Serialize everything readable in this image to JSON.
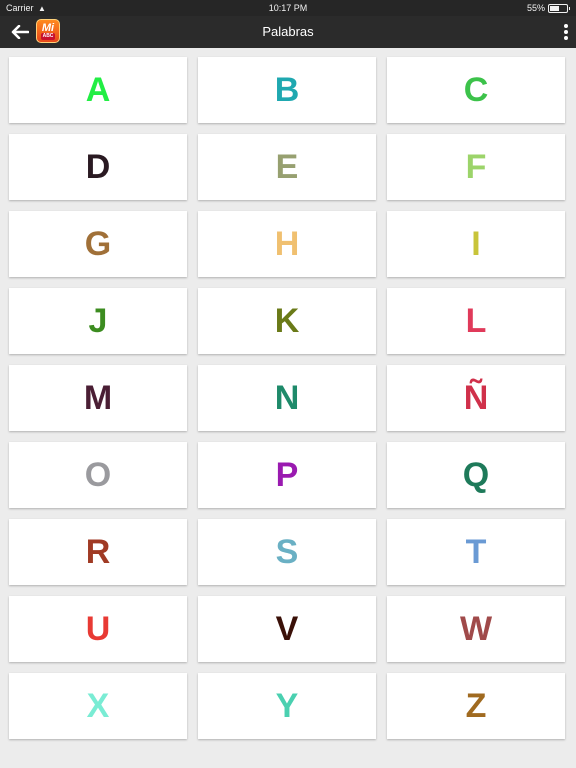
{
  "status_bar": {
    "carrier": "Carrier",
    "time": "10:17 PM",
    "battery": "55%",
    "battery_level": 0.55
  },
  "nav": {
    "title": "Palabras",
    "back_icon": "arrow-left-icon",
    "logo": {
      "top": "Mi",
      "bottom": "ABC"
    },
    "menu_icon": "more-vertical-icon"
  },
  "letters": [
    {
      "letter": "A",
      "color": "#22ee44"
    },
    {
      "letter": "B",
      "color": "#1fa8b0"
    },
    {
      "letter": "C",
      "color": "#3cc24a"
    },
    {
      "letter": "D",
      "color": "#2a1a22"
    },
    {
      "letter": "E",
      "color": "#97a070"
    },
    {
      "letter": "F",
      "color": "#9cd46a"
    },
    {
      "letter": "G",
      "color": "#a07038"
    },
    {
      "letter": "H",
      "color": "#f0c070"
    },
    {
      "letter": "I",
      "color": "#c8c43a"
    },
    {
      "letter": "J",
      "color": "#3c8c20"
    },
    {
      "letter": "K",
      "color": "#6a7a18"
    },
    {
      "letter": "L",
      "color": "#e03a5a"
    },
    {
      "letter": "M",
      "color": "#4a1e34"
    },
    {
      "letter": "N",
      "color": "#1e8a6a"
    },
    {
      "letter": "Ñ",
      "color": "#d0304a"
    },
    {
      "letter": "O",
      "color": "#9a9a9e"
    },
    {
      "letter": "P",
      "color": "#9a1ab0"
    },
    {
      "letter": "Q",
      "color": "#1e7a5a"
    },
    {
      "letter": "R",
      "color": "#a03a24"
    },
    {
      "letter": "S",
      "color": "#6ab0c4"
    },
    {
      "letter": "T",
      "color": "#6a9ad4"
    },
    {
      "letter": "U",
      "color": "#e83a34"
    },
    {
      "letter": "V",
      "color": "#3a1008"
    },
    {
      "letter": "W",
      "color": "#a04a4a"
    },
    {
      "letter": "X",
      "color": "#7aecd4"
    },
    {
      "letter": "Y",
      "color": "#4ad0b0"
    },
    {
      "letter": "Z",
      "color": "#a06a20"
    }
  ]
}
